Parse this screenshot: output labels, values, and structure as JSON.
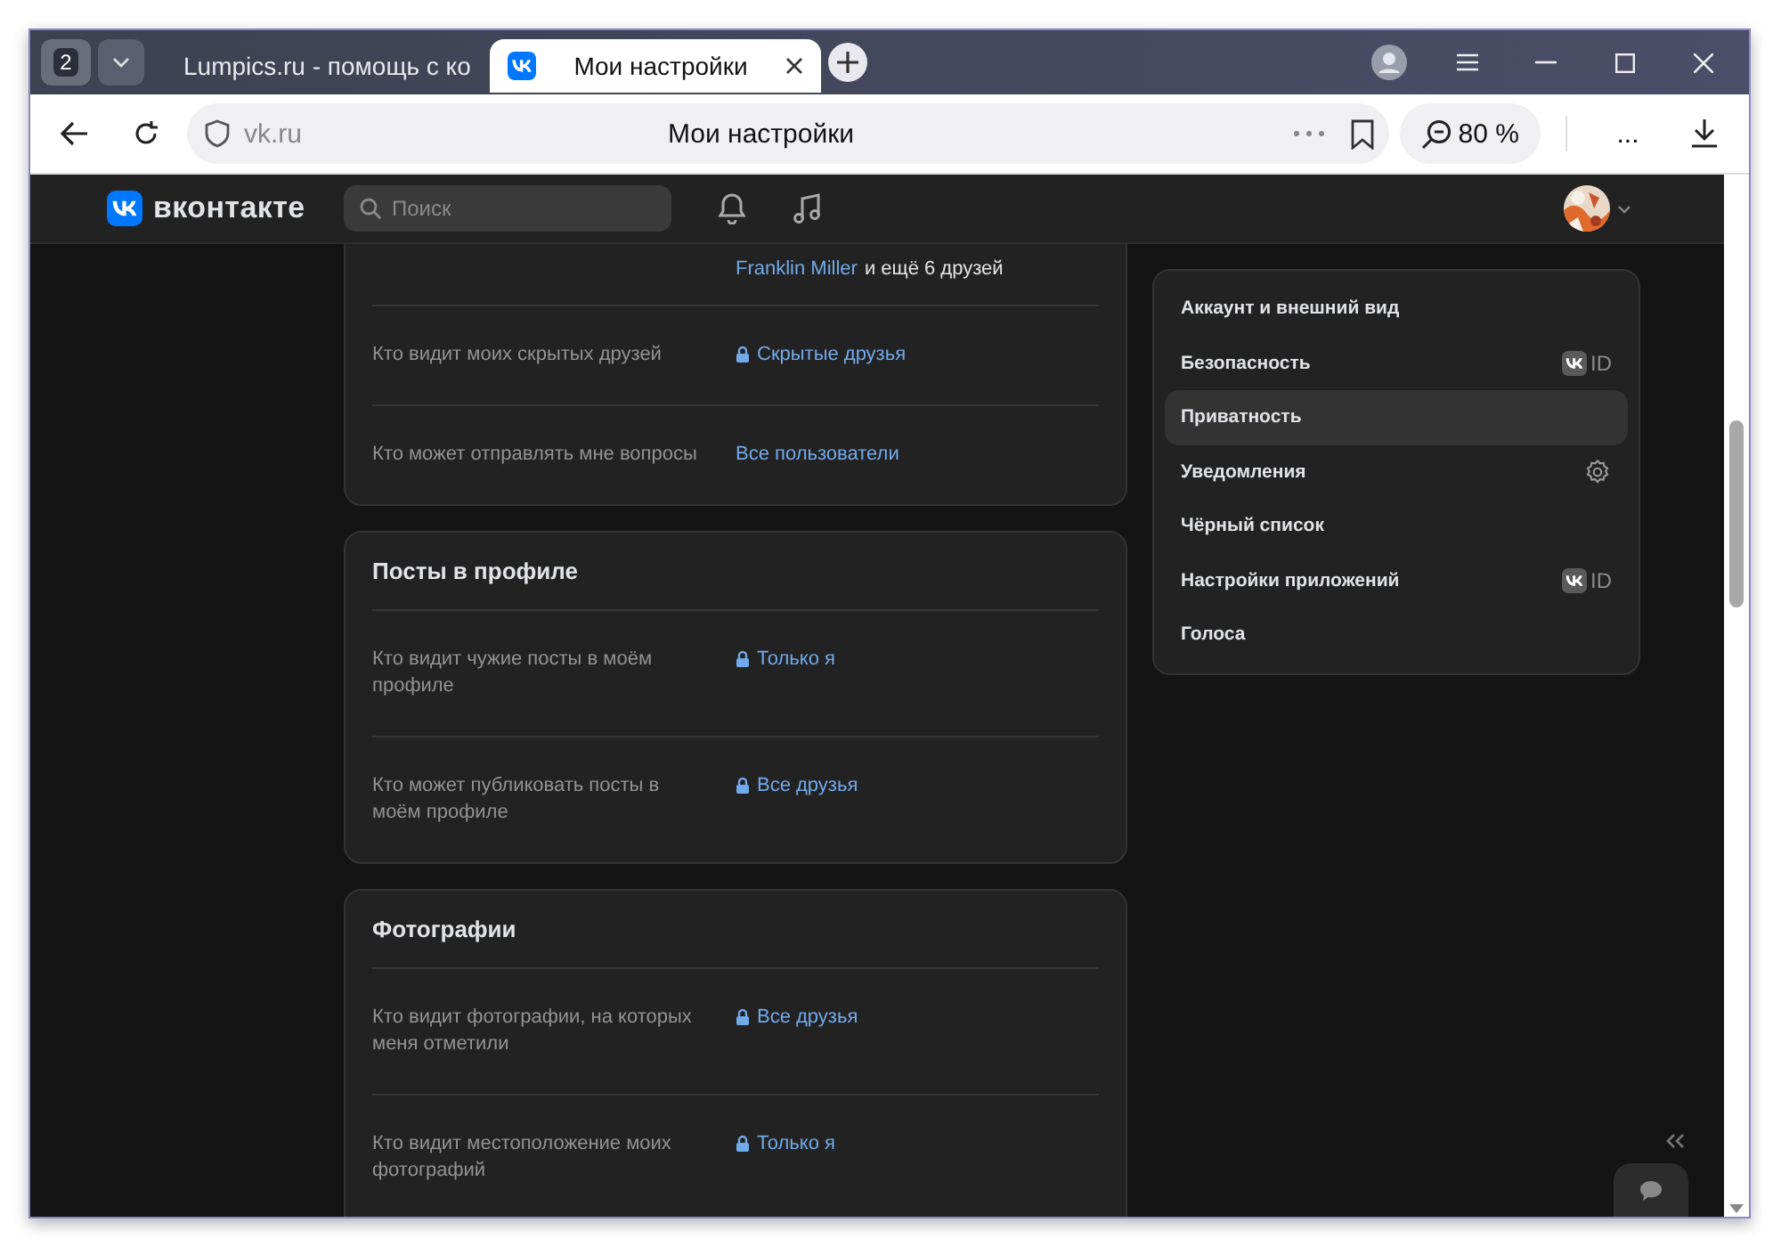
{
  "browser": {
    "tab_count": "2",
    "tabs": [
      {
        "title": "Lumpics.ru - помощь с ко",
        "selected": false,
        "kind": "lumpics"
      },
      {
        "title": "Мои настройки",
        "selected": true,
        "kind": "vk"
      }
    ],
    "address": {
      "domain": "vk.ru",
      "page_title": "Мои настройки"
    },
    "zoom": "80 %",
    "more": "..."
  },
  "header": {
    "logo": "вконтакте",
    "search": {
      "placeholder": "Поиск"
    }
  },
  "cards": [
    {
      "rows": [
        {
          "label": "",
          "value_link": "Franklin Miller",
          "value_rest": "и ещё 6 друзей",
          "locked": false
        },
        {
          "label": "Кто видит моих скрытых друзей",
          "value_link": "Скрытые друзья",
          "locked": true
        },
        {
          "label": "Кто может отправлять мне вопросы",
          "value_link": "Все пользователи",
          "locked": false
        }
      ]
    },
    {
      "title": "Посты в профиле",
      "rows": [
        {
          "label": "Кто видит чужие посты в моём профиле",
          "value_link": "Только я",
          "locked": true
        },
        {
          "label": "Кто может публиковать посты в моём профиле",
          "value_link": "Все друзья",
          "locked": true
        }
      ]
    },
    {
      "title": "Фотографии",
      "rows": [
        {
          "label": "Кто видит фотографии, на которых меня отметили",
          "value_link": "Все друзья",
          "locked": true
        },
        {
          "label": "Кто видит местоположение моих фотографий",
          "value_link": "Только я",
          "locked": true
        }
      ]
    }
  ],
  "menu": [
    {
      "label": "Аккаунт и внешний вид",
      "selected": false,
      "kind": "plain"
    },
    {
      "label": "Безопасность",
      "selected": false,
      "kind": "vkid",
      "badge": "ID"
    },
    {
      "label": "Приватность",
      "selected": true,
      "kind": "plain"
    },
    {
      "label": "Уведомления",
      "selected": false,
      "kind": "settings"
    },
    {
      "label": "Чёрный список",
      "selected": false,
      "kind": "plain"
    },
    {
      "label": "Настройки приложений",
      "selected": false,
      "kind": "vkid",
      "badge": "ID"
    },
    {
      "label": "Голоса",
      "selected": false,
      "kind": "plain"
    }
  ]
}
